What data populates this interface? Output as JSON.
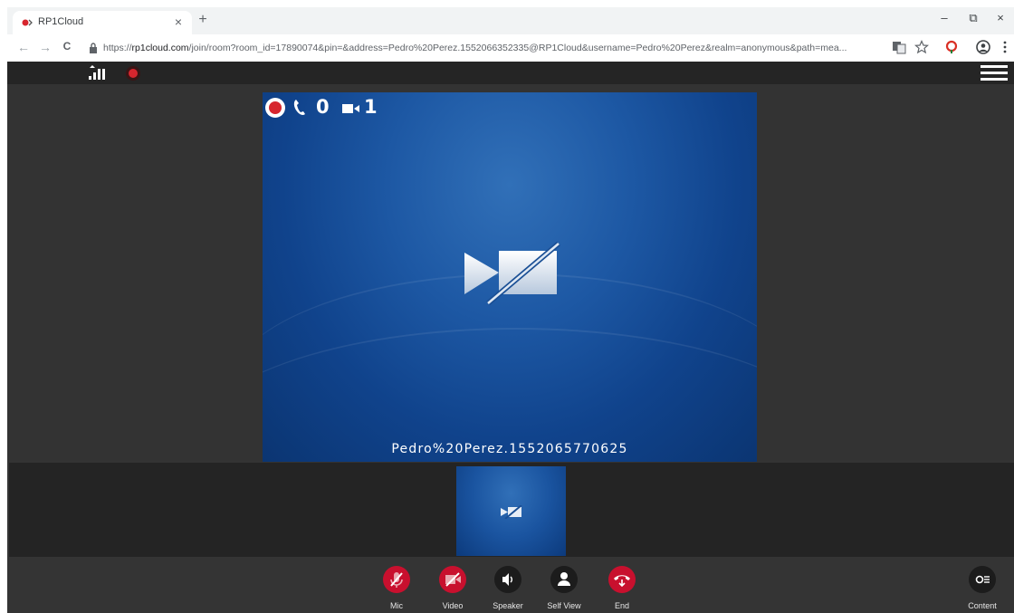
{
  "browser": {
    "tab_title": "RP1Cloud",
    "tab_close": "×",
    "new_tab": "+",
    "window_controls": {
      "minimize": "–",
      "restore": "⧉",
      "close": "×"
    },
    "nav": {
      "back": "←",
      "forward": "→",
      "reload": "C"
    },
    "url_prefix": "https://",
    "url_host": "rp1cloud.com",
    "url_rest": "/join/room?room_id=17890074&pin=&address=Pedro%20Perez.1552066352335@RP1Cloud&username=Pedro%20Perez&realm=anonymous&path=mea...",
    "icons": [
      "translate-icon",
      "star-icon",
      "extension-icon",
      "account-icon",
      "menu-dots-icon"
    ]
  },
  "call": {
    "audio_count": "0",
    "video_count": "1",
    "participant_name": "Pedro%20Perez.1552065770625"
  },
  "toolbar": {
    "mic_label": "Mic",
    "video_label": "Video",
    "speaker_label": "Speaker",
    "selfview_label": "Self View",
    "end_label": "End",
    "content_label": "Content"
  },
  "colors": {
    "accent_red": "#c8102e",
    "video_blue": "#1d58a4",
    "app_bg": "#343434"
  }
}
